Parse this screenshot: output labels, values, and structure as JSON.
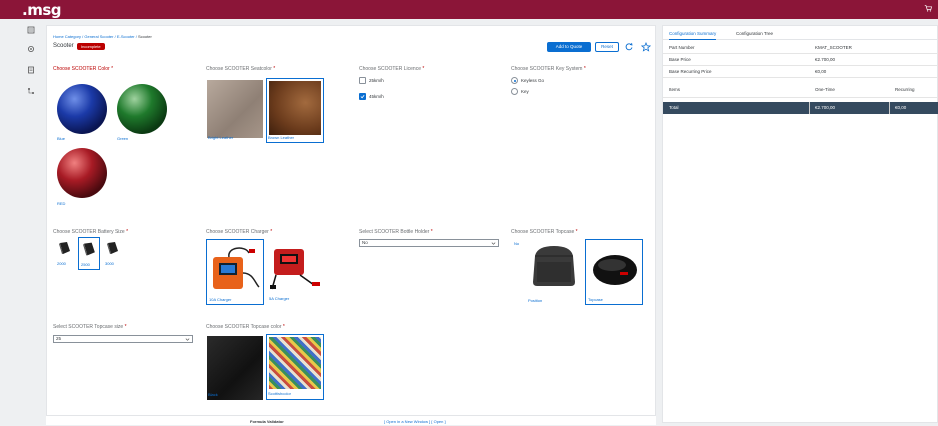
{
  "header": {
    "logo": ".msg"
  },
  "breadcrumb": [
    "Home Category",
    "General Scooter",
    "E-Scooter",
    "Scooter"
  ],
  "product": {
    "title": "Scooter",
    "status": "Incomplete"
  },
  "toolbar": {
    "add_to_quote": "Add to Quote",
    "reset": "Reset"
  },
  "color": {
    "label": "Choose SCOOTER Color",
    "options": [
      "Blue",
      "Green",
      "RED"
    ]
  },
  "seatcolor": {
    "label": "Choose SCOOTER Seatcolor",
    "options": [
      "Bright Leather",
      "Brown Leather"
    ]
  },
  "licence": {
    "label": "Choose SCOOTER Licence",
    "options": [
      "25km/h",
      "45km/h"
    ],
    "selected": "45km/h"
  },
  "keysystem": {
    "label": "Choose SCOOTER Key System",
    "options": [
      "Keyless Go",
      "Key"
    ],
    "selected": "Keyless Go"
  },
  "battery": {
    "label": "Choose SCOOTER Battery Size",
    "options": [
      "2000",
      "2500",
      "3000"
    ],
    "selected": "2500"
  },
  "charger": {
    "label": "Choose SCOOTER Charger",
    "options": [
      "10A Charger",
      "5A Charger"
    ],
    "selected": "10A Charger"
  },
  "bottle": {
    "label": "Select SCOOTER Bottle Holder",
    "value": "No"
  },
  "topcase": {
    "label": "Choose SCOOTER Topcase",
    "no_label": "No",
    "options": [
      "Position",
      "Topcase"
    ],
    "selected": "Topcase"
  },
  "topcasesize": {
    "label": "Select SCOOTER Topcase size",
    "value": "25"
  },
  "topcasecolor": {
    "label": "Choose SCOOTER Topcase color",
    "options": [
      "Black",
      "Scottishcolor"
    ],
    "selected": "Scottishcolor"
  },
  "footer": {
    "title": "Formula Validator",
    "links": "[ Open in a New Window ] [ Open ]"
  },
  "summary": {
    "tabs": [
      "Configuration Summary",
      "Configuration Tree"
    ],
    "rows": [
      {
        "k": "Part Number",
        "v": "KMAT_SCOOTER"
      },
      {
        "k": "Base Price",
        "v": "€2.700,00"
      },
      {
        "k": "Base Recurring Price",
        "v": "€0,00"
      }
    ],
    "items_header": {
      "k": "Items",
      "v": "One-Time",
      "v2": "Recurring"
    },
    "total": {
      "k": "Total",
      "v": "€2.700,00",
      "v2": "€0,00"
    }
  },
  "colors": {
    "brand": "#8b1538",
    "accent": "#0a6ed1",
    "danger": "#bb0000",
    "total_bg": "#354a5f"
  }
}
